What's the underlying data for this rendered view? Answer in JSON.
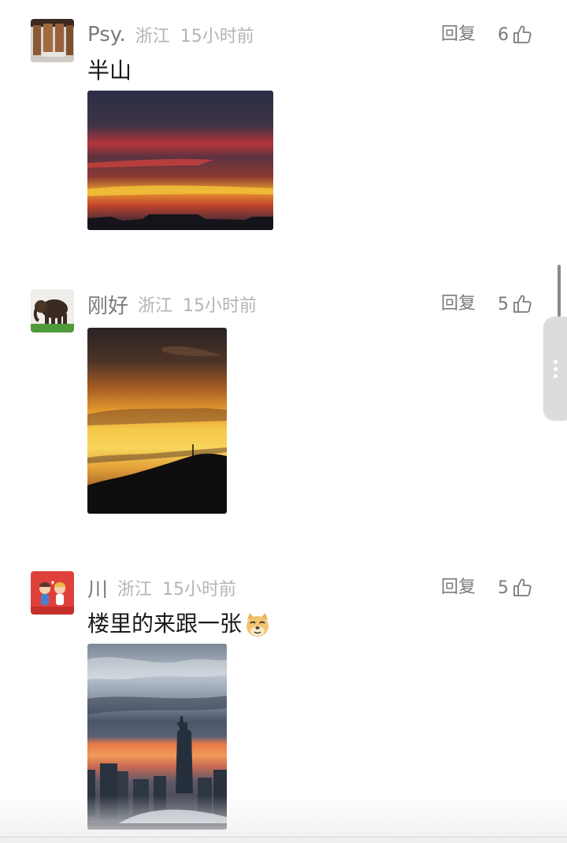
{
  "comments": [
    {
      "username": "Psy.",
      "location": "浙江",
      "time": "15小时前",
      "reply_label": "回复",
      "likes": "6",
      "text": "半山",
      "avatar_icon": "wooden-pillars-avatar",
      "photo_icon": "sunset-clouds-photo"
    },
    {
      "username": "刚好",
      "location": "浙江",
      "time": "15小时前",
      "reply_label": "回复",
      "likes": "5",
      "text": "",
      "avatar_icon": "elephant-avatar",
      "photo_icon": "sunset-hill-photo"
    },
    {
      "username": "川",
      "location": "浙江",
      "time": "15小时前",
      "reply_label": "回复",
      "likes": "5",
      "text": "楼里的来跟一张",
      "avatar_icon": "cartoon-couple-avatar",
      "photo_icon": "tower-sunset-photo",
      "emoji_icon": "doge-emoji"
    }
  ],
  "colors": {
    "username": "#7b7b7b",
    "meta": "#b4b4b4",
    "text": "#1a1a1a"
  }
}
